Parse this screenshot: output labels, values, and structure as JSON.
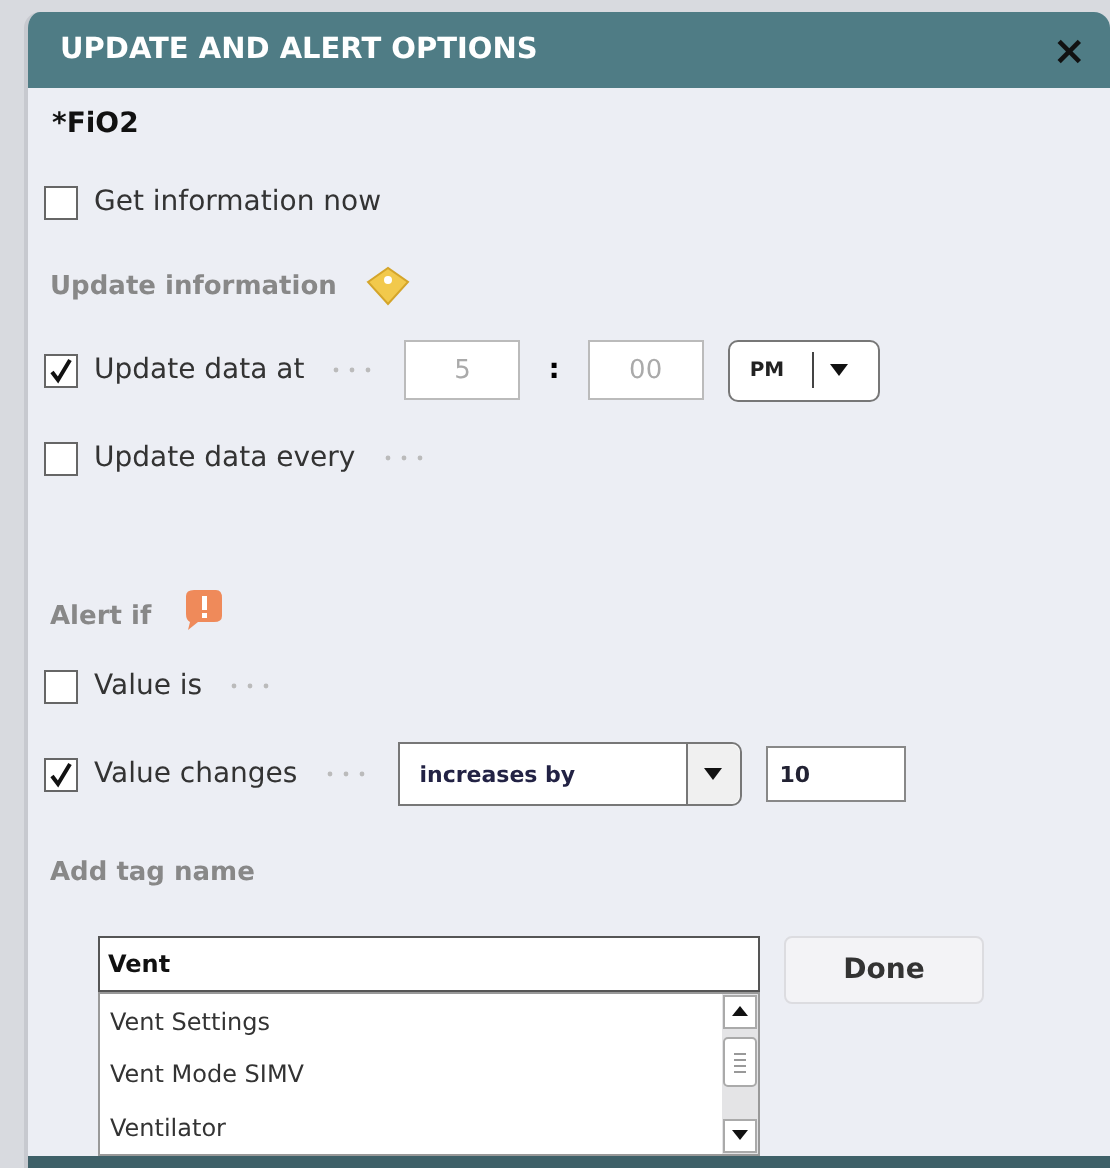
{
  "dialog": {
    "title": "UPDATE AND ALERT OPTIONS",
    "close": "×"
  },
  "parameter": "*FiO2",
  "get_now": {
    "label": "Get information now",
    "checked": false
  },
  "update_section": {
    "heading": "Update information"
  },
  "update_at": {
    "label": "Update data at",
    "checked": true,
    "hour": "5",
    "separator": ":",
    "minute": "00",
    "period": "PM"
  },
  "update_every": {
    "label": "Update data every",
    "checked": false
  },
  "alert_section": {
    "heading": "Alert if"
  },
  "value_is": {
    "label": "Value is",
    "checked": false
  },
  "value_changes": {
    "label": "Value changes",
    "checked": true,
    "condition": "increases by",
    "amount": "10"
  },
  "tag": {
    "heading": "Add tag name",
    "value": "Vent",
    "done": "Done",
    "suggestions": [
      {
        "label": "Vent Settings"
      },
      {
        "label": "Vent Mode SIMV"
      },
      {
        "label": "Ventilator"
      }
    ]
  }
}
